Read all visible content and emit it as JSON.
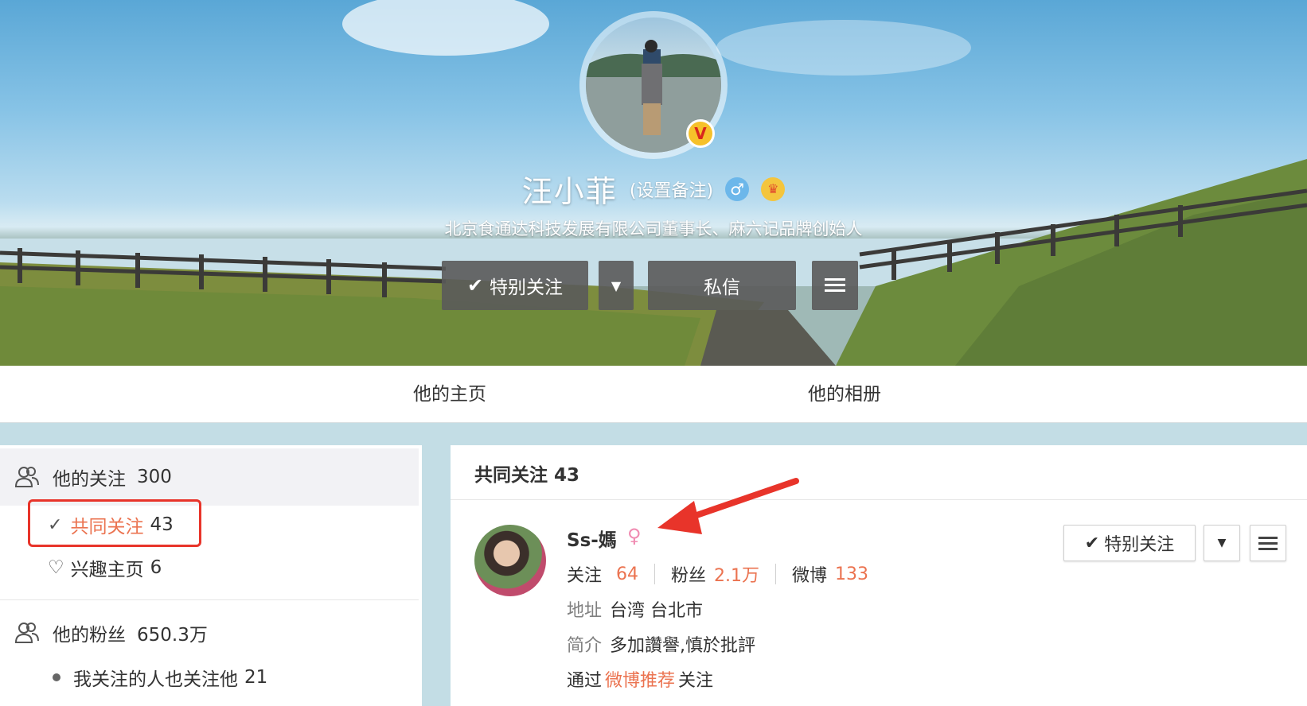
{
  "profile": {
    "name": "汪小菲",
    "remark_label": "(设置备注)",
    "gender_icon": "male-icon",
    "member_icon": "crown-icon",
    "verified_badge": "V",
    "bio": "北京食通达科技发展有限公司董事长、麻六记品牌创始人"
  },
  "actions": {
    "follow_label": "特别关注",
    "dropdown_icon": "chevron-down-icon",
    "message_label": "私信",
    "menu_icon": "hamburger-icon"
  },
  "nav": {
    "home": "他的主页",
    "album": "他的相册"
  },
  "sidebar": {
    "following": {
      "label": "他的关注",
      "count": "300"
    },
    "common": {
      "label": "共同关注",
      "count": "43"
    },
    "interest": {
      "label": "兴趣主页",
      "count": "6"
    },
    "fans": {
      "label": "他的粉丝",
      "count": "650.3万"
    },
    "fans_sub": {
      "label": "我关注的人也关注他",
      "count": "21"
    }
  },
  "main": {
    "title": "共同关注 43",
    "user": {
      "name": "Ss-媽",
      "gender_icon": "female-icon",
      "following_label": "关注",
      "following_count": "64",
      "fans_label": "粉丝",
      "fans_count": "2.1万",
      "weibo_label": "微博",
      "weibo_count": "133",
      "address_label": "地址",
      "address": "台湾 台北市",
      "intro_label": "简介",
      "intro": "多加讚譽,慎於批評",
      "via_prefix": "通过",
      "via_link": "微博推荐",
      "via_suffix": "关注",
      "follow_label": "特别关注"
    }
  },
  "colors": {
    "accent": "#eb7350",
    "highlight": "#e8342a",
    "page_bg": "#c3dde5"
  }
}
